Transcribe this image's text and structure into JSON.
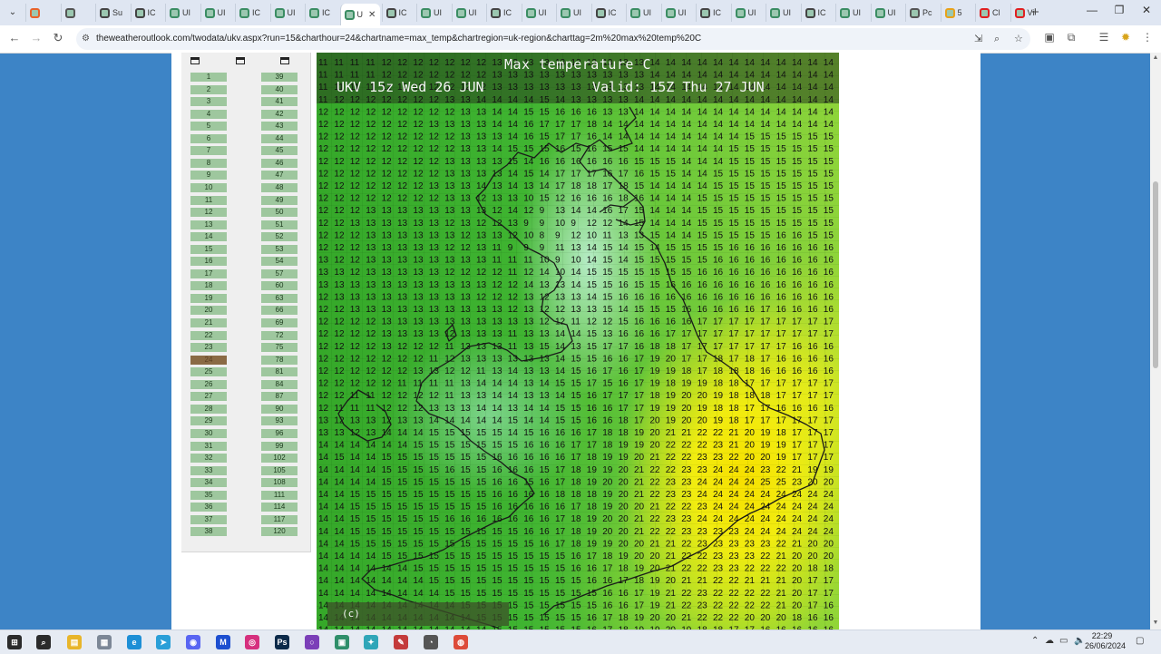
{
  "browser": {
    "tabs": [
      {
        "label": "",
        "icon": "office-icon",
        "color": "#e8622a"
      },
      {
        "label": "",
        "icon": "speaker-icon",
        "color": "#555555"
      },
      {
        "label": "Su",
        "icon": "globe-icon",
        "color": "#444444"
      },
      {
        "label": "IC",
        "icon": "globe-icon",
        "color": "#444444"
      },
      {
        "label": "UI",
        "icon": "weather-site-icon",
        "color": "#3b8d63"
      },
      {
        "label": "UI",
        "icon": "weather-site-icon",
        "color": "#3b8d63"
      },
      {
        "label": "IC",
        "icon": "weather-site-icon",
        "color": "#3b8d63"
      },
      {
        "label": "UI",
        "icon": "weather-site-icon",
        "color": "#3b8d63"
      },
      {
        "label": "IC",
        "icon": "weather-site-icon",
        "color": "#3b8d63"
      },
      {
        "label": "U",
        "icon": "weather-site-icon",
        "color": "#3b8d63",
        "active": true
      },
      {
        "label": "IC",
        "icon": "globe-icon",
        "color": "#444444"
      },
      {
        "label": "UI",
        "icon": "weather-site-icon",
        "color": "#3b8d63"
      },
      {
        "label": "UI",
        "icon": "weather-site-icon",
        "color": "#3b8d63"
      },
      {
        "label": "IC",
        "icon": "globe-icon",
        "color": "#444444"
      },
      {
        "label": "UI",
        "icon": "weather-site-icon",
        "color": "#3b8d63"
      },
      {
        "label": "UI",
        "icon": "weather-site-icon",
        "color": "#3b8d63"
      },
      {
        "label": "IC",
        "icon": "globe-icon",
        "color": "#444444"
      },
      {
        "label": "UI",
        "icon": "weather-site-icon",
        "color": "#3b8d63"
      },
      {
        "label": "UI",
        "icon": "weather-site-icon",
        "color": "#3b8d63"
      },
      {
        "label": "IC",
        "icon": "globe-icon",
        "color": "#444444"
      },
      {
        "label": "UI",
        "icon": "weather-site-icon",
        "color": "#3b8d63"
      },
      {
        "label": "UI",
        "icon": "weather-site-icon",
        "color": "#3b8d63"
      },
      {
        "label": "IC",
        "icon": "globe-icon",
        "color": "#444444"
      },
      {
        "label": "UI",
        "icon": "weather-site-icon",
        "color": "#3b8d63"
      },
      {
        "label": "UI",
        "icon": "weather-site-icon",
        "color": "#3b8d63"
      },
      {
        "label": "Pc",
        "icon": "cloud-icon",
        "color": "#555555"
      },
      {
        "label": "5",
        "icon": "sun-icon",
        "color": "#e8a21a"
      },
      {
        "label": "Cl",
        "icon": "youtube-icon",
        "color": "#e02020"
      },
      {
        "label": "Vi",
        "icon": "youtube-icon",
        "color": "#e02020"
      }
    ],
    "active_tab_close": "✕",
    "new_tab": "+",
    "url": "theweatheroutlook.com/twodata/ukv.aspx?run=15&charthour=24&chartname=max_temp&chartregion=uk-region&charttag=2m%20max%20temp%20C"
  },
  "sidebar": {
    "left_column": [
      "1",
      "2",
      "3",
      "4",
      "5",
      "6",
      "7",
      "8",
      "9",
      "10",
      "11",
      "12",
      "13",
      "14",
      "15",
      "16",
      "17",
      "18",
      "19",
      "20",
      "21",
      "22",
      "23",
      "24",
      "25",
      "26",
      "27",
      "28",
      "29",
      "30",
      "31",
      "32",
      "33",
      "34",
      "35",
      "36",
      "37",
      "38"
    ],
    "right_column": [
      "39",
      "40",
      "41",
      "42",
      "43",
      "44",
      "45",
      "46",
      "47",
      "48",
      "49",
      "50",
      "51",
      "52",
      "53",
      "54",
      "57",
      "60",
      "63",
      "66",
      "69",
      "72",
      "75",
      "78",
      "81",
      "84",
      "87",
      "90",
      "93",
      "96",
      "99",
      "102",
      "105",
      "108",
      "111",
      "114",
      "117",
      "120"
    ],
    "selected_hour": "24",
    "selected_color": "#8a6a45",
    "button_color": "#9ec79e"
  },
  "chart": {
    "title": "Max temperature C",
    "run_label": "UKV 15z Wed 26 JUN",
    "valid_label": "Valid: 15Z Thu 27 JUN",
    "credit": "(c) www.theweatheroutlook.com",
    "rows": [
      "11 11 11 11 12 12 12 12 12 12 12 13 13 13 13 13 13 13 13 13 13 14 14 14 14 14 14 14 14 14 14 14 14",
      "11 11 11 11 12 12 12 12 12 12 12 13 13 13 13 13 13 13 13 13 13 14 14 14 14 14 14 14 14 14 14 14 14",
      "11 11 11 11 12 12 12 12 12 12 12 13 13 13 13 13 13 13 13 13 13 14 14 14 14 14 14 14 14 14 14 14 14",
      "11 12 12 12 12 12 12 12 13 13 14 14 14 14 15 14 13 13 13 13 14 14 14 14 14 14 14 14 14 14 14 14 14",
      "12 12 12 12 12 12 12 12 12 13 13 14 14 15 15 16 16 16 13 13 14 14 14 14 14 14 14 14 14 14 14 14 14",
      "12 12 12 12 12 12 12 13 13 13 13 14 14 16 17 17 17 18 14 14 14 14 14 14 14 14 14 14 14 14 14 14 14",
      "12 12 12 12 12 12 12 12 12 13 13 13 14 16 15 17 17 16 14 14 14 14 14 14 14 14 14 15 15 15 15 15 15",
      "12 12 12 12 12 12 12 12 12 13 13 14 15 15 15 16 15 16 15 15 14 14 14 14 14 14 15 15 15 15 15 15 15",
      "12 12 12 12 12 12 12 12 13 13 13 13 15 14 16 16 16 16 16 16 15 15 15 14 14 14 15 15 15 15 15 15 15",
      "12 12 12 12 12 12 12 12 13 13 13 13 14 15 14 17 17 17 16 17 16 15 15 14 14 15 15 15 15 15 15 15 15",
      "12 12 12 12 12 12 12 13 13 13 14 13 14 13 14 17 18 18 17 18 15 14 14 14 14 15 15 15 15 15 15 15 15",
      "12 12 12 12 12 12 12 12 13 13 12 13 13 10 15 12 16 16 16 18 16 14 14 14 15 15 15 15 15 15 15 15 15",
      "12 12 12 13 13 13 13 13 13 13 13 12 14 12 9 13 14 14 16 17 15 14 14 14 15 15 15 15 15 15 15 15 15",
      "12 12 13 13 13 13 13 13 12 13 12 12 13 9 9 10 9 12 12 14 15 14 14 14 15 15 15 15 15 15 15 15 15",
      "12 12 12 13 13 13 13 13 13 12 13 13 12 10 8 9 12 10 11 13 13 15 14 14 15 15 15 15 15 16 16 15 15",
      "12 12 12 13 13 13 13 13 12 12 13 11 9 9 9 11 13 14 15 14 15 14 15 15 15 15 16 16 16 16 16 16 16",
      "13 12 12 13 13 13 13 13 13 13 13 11 11 11 10 9 10 14 15 14 15 15 15 15 15 16 16 16 16 16 16 16 16",
      "13 13 12 13 13 13 13 13 12 12 12 12 11 12 14 10 14 15 15 15 15 15 15 15 16 16 16 16 16 16 16 16 16",
      "13 13 13 13 13 13 13 13 13 13 13 12 12 14 13 13 14 15 15 16 15 15 16 16 16 16 16 16 16 16 16 16 16",
      "12 13 13 13 13 13 13 13 13 13 12 12 12 13 12 13 13 14 15 16 16 16 16 16 16 16 16 16 16 16 16 16 16",
      "12 12 13 13 13 13 13 13 13 13 13 13 12 13 12 12 13 13 15 14 15 15 15 16 16 16 16 16 17 16 16 16 16",
      "12 12 12 12 13 13 13 13 13 13 13 13 13 13 12 12 11 12 12 15 16 16 16 16 17 17 17 17 17 17 17 17 17",
      "12 12 12 12 13 13 13 13 12 13 13 13 11 13 13 14 14 15 13 16 16 16 17 17 17 17 17 17 17 17 17 17 17",
      "12 12 12 12 13 12 12 12 11 13 13 13 11 13 15 14 13 15 17 17 16 18 18 17 17 17 17 17 17 17 16 16 16",
      "12 12 12 12 12 12 12 11 12 13 13 13 13 13 13 14 15 15 16 16 17 19 20 17 17 18 17 18 17 16 16 16 16",
      "12 12 12 12 12 12 13 13 12 12 11 13 14 13 13 14 15 16 17 16 17 19 19 18 17 18 18 18 16 16 16 16 16",
      "12 12 12 12 12 11 11 11 11 13 14 14 14 13 14 15 15 17 15 16 17 19 18 19 19 18 18 17 17 17 17 17 17",
      "12 12 11 11 12 12 12 12 11 13 13 14 14 13 13 14 15 16 17 17 17 18 19 20 20 19 18 18 18 17 17 17 17",
      "12 11 11 11 12 12 12 13 13 13 14 14 13 14 14 15 15 16 16 17 17 19 19 20 19 18 18 17 17 16 16 16 16",
      "13 12 13 13 12 13 13 14 14 14 14 14 15 14 14 15 15 16 16 18 17 20 19 20 20 19 18 17 17 17 17 17 17",
      "13 13 12 13 14 14 14 15 15 15 15 15 14 15 16 16 16 17 18 18 19 20 21 21 22 22 21 20 19 18 17 17 17",
      "14 14 14 14 14 14 15 15 15 15 15 15 15 16 16 16 17 17 18 19 19 20 22 22 22 23 21 20 19 19 17 17 17",
      "14 15 14 14 15 15 15 15 15 15 15 16 16 16 16 16 17 18 19 19 20 21 22 22 23 23 22 20 20 19 17 17 17",
      "14 14 14 14 15 15 15 15 16 15 15 16 16 16 15 17 18 19 19 20 21 22 22 23 23 24 24 24 23 22 21 19 19",
      "14 14 14 14 15 15 15 15 15 15 15 16 16 15 16 17 18 19 20 20 21 22 23 23 24 24 24 24 25 25 23 20 20",
      "14 14 15 15 15 15 15 15 15 15 15 16 16 16 16 18 18 18 19 20 21 22 23 23 24 24 24 24 24 24 24 24 24",
      "14 14 15 15 15 15 15 15 15 15 15 16 16 16 16 16 17 18 19 20 20 21 22 22 23 24 24 24 24 24 24 24 24",
      "14 14 15 15 15 15 15 15 16 16 16 16 16 16 16 17 18 19 20 20 21 22 23 23 24 24 24 24 24 24 24 24 24",
      "14 14 15 15 15 15 15 15 15 15 15 15 15 16 16 17 18 19 20 20 21 22 22 23 23 23 23 24 24 24 24 24 24",
      "14 14 15 15 15 15 15 15 15 15 15 15 15 15 16 17 18 19 19 20 20 21 21 22 23 23 23 23 23 22 21 20 20",
      "14 14 14 14 15 15 15 15 15 15 15 15 15 15 15 15 16 17 18 19 20 20 21 22 22 23 23 23 22 21 20 20 20",
      "14 14 14 14 14 14 15 15 15 15 15 15 15 15 15 15 16 16 17 18 19 20 21 22 22 23 23 22 22 22 20 18 18",
      "14 14 14 14 14 14 14 15 15 15 15 15 15 15 15 15 15 16 16 17 18 19 20 21 21 22 22 21 21 21 20 17 17",
      "14 14 14 14 14 14 14 14 15 15 15 15 15 15 15 15 15 15 16 16 17 19 21 22 23 22 22 22 22 21 20 17 17",
      "14 14 14 14 14 14 14 14 14 15 15 15 15 15 15 15 15 15 16 16 17 19 21 22 23 22 22 22 22 21 20 17 16",
      "14 14 14 14 14 14 14 14 14 14 15 15 15 15 15 15 15 16 17 18 19 20 20 21 22 22 22 20 20 20 18 16 16",
      "14 14 14 14 14 14 14 14 14 14 14 15 15 15 15 15 15 16 17 18 19 19 20 19 18 18 17 17 16 16 16 16 16",
      "14 14 14 14 14 14 14 14 14 14 14 14 15 15 15 15 15 16 17 18 19 19 20 19 18 17 17 16 16 16 16 16 16",
      "14 14 14 14 14 14 14 14 14 14 14 14 15 15 15 15 15 15 16 17 17 17 17 17 17 16 16 16 16 16 16 16 16",
      "14 14 14 14 14 14 14 14 14 14 14 14 14 15 15 15 15 15 15 16 17 17 17 16 16 16 16 16 16 16 16 16 16"
    ]
  },
  "taskbar": {
    "apps": [
      {
        "icon": "windows-start-icon",
        "color": "#2b2b2b"
      },
      {
        "icon": "search-icon",
        "color": "#2b2b2b"
      },
      {
        "icon": "file-explorer-icon",
        "color": "#e8b52a"
      },
      {
        "icon": "folder-icon",
        "color": "#7c8796"
      },
      {
        "icon": "edge-icon",
        "color": "#1d8fd6"
      },
      {
        "icon": "telegram-icon",
        "color": "#2a9fd8"
      },
      {
        "icon": "discord-icon",
        "color": "#5865f2"
      },
      {
        "icon": "malwarebytes-icon",
        "color": "#1d4fd0"
      },
      {
        "icon": "instagram-icon",
        "color": "#d6307e"
      },
      {
        "icon": "photoshop-icon",
        "color": "#0c2a4a"
      },
      {
        "icon": "circle-app-icon",
        "color": "#7b3fb8"
      },
      {
        "icon": "terminal-icon",
        "color": "#2f8f6a"
      },
      {
        "icon": "copilot-icon",
        "color": "#2fa6b8"
      },
      {
        "icon": "paint-icon",
        "color": "#c43b3b"
      },
      {
        "icon": "clock-app-icon",
        "color": "#555555"
      },
      {
        "icon": "chrome-icon",
        "color": "#dd4b39"
      }
    ],
    "time": "22:29",
    "date": "26/06/2024"
  }
}
